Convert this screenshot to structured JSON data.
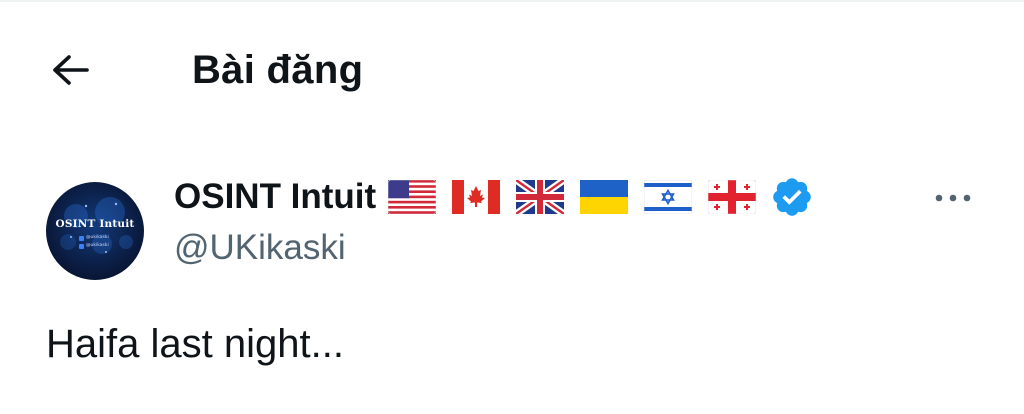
{
  "header": {
    "back_icon": "arrow-left-icon",
    "title": "Bài đăng"
  },
  "author": {
    "avatar_text": "OSINT Intuit",
    "avatar_line1": "@ukikaski",
    "avatar_line2": "@ukikaski",
    "display_name": "OSINT Intuit",
    "flags": [
      "us-flag",
      "canada-flag",
      "uk-flag",
      "ukraine-flag",
      "israel-flag",
      "georgia-flag"
    ],
    "verified_icon": "verified-badge-icon",
    "verified_color": "#1d9bf0",
    "handle": "@UKikaski",
    "more_icon": "more-horizontal-icon"
  },
  "post": {
    "text": "Haifa last night..."
  },
  "colors": {
    "text_primary": "#0f1419",
    "text_secondary": "#536471"
  }
}
